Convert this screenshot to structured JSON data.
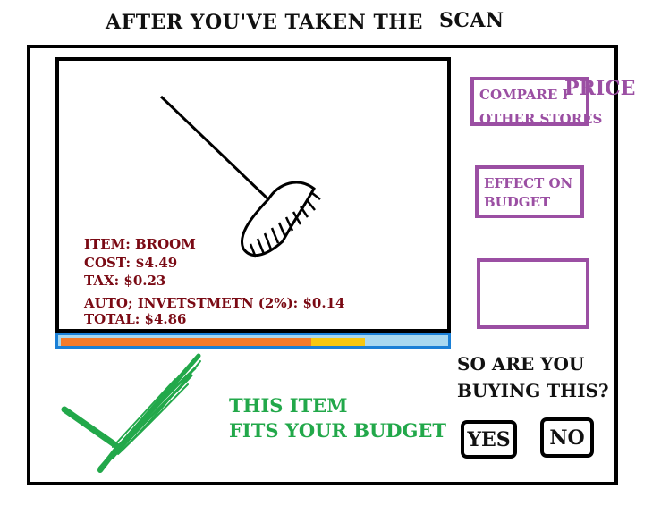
{
  "header": {
    "title_lead": "AFTER YOU'VE TAKEN THE",
    "title_tail": "SCAN"
  },
  "scan": {
    "image_icon": "broom-icon",
    "item_line": "ITEM: BROOM",
    "cost_line": "COST:  $4.49",
    "tax_line": "TAX:   $0.23",
    "invest_line": "AUTO; INVETSTMETN (2%): $0.14",
    "total_line": "TOTAL: $4.86"
  },
  "budget_bar": {
    "spent_fraction": 0.65,
    "item_fraction": 0.14,
    "colors": {
      "spent": "#f47b2a",
      "item": "#f7c710",
      "remaining": "#a8d8f0",
      "border": "#1a7fd6"
    }
  },
  "side_buttons": {
    "compare_label": "COMPARE PRICE",
    "compare_label_end": "OTHER STORES",
    "effect_label": "EFFECT ON",
    "effect_label_end": "BUDGET"
  },
  "decision": {
    "question_line1": "SO ARE YOU",
    "question_line2": "BUYING THIS?",
    "yes_label": "YES",
    "no_label": "NO"
  },
  "feedback": {
    "line1": "THIS ITEM",
    "line2": "FITS YOUR BUDGET",
    "icon": "checkmark-icon",
    "color": "#22a84a"
  }
}
